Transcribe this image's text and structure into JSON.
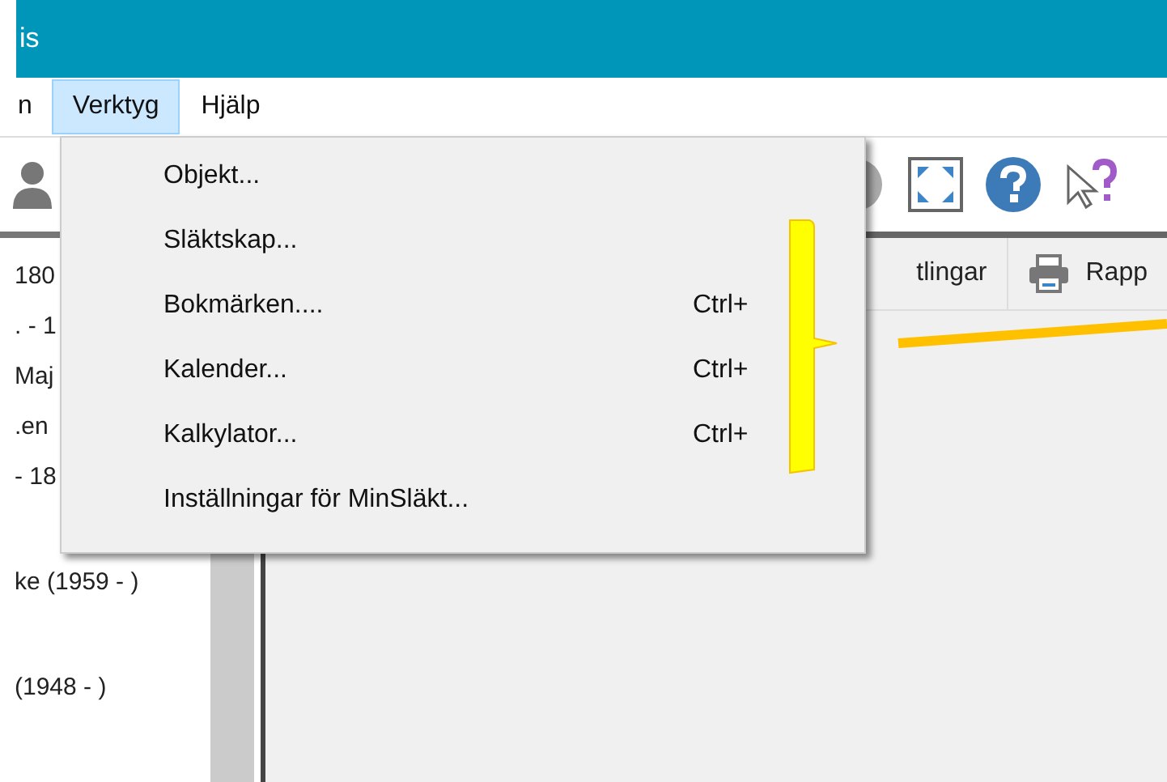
{
  "window": {
    "title": "is"
  },
  "menu_bar": [
    {
      "label": "n",
      "selected": false
    },
    {
      "label": "Verktyg",
      "selected": true
    },
    {
      "label": "Hjälp",
      "selected": false
    }
  ],
  "toolbar": {
    "items": [
      {
        "kind": "person"
      },
      {
        "kind": "disc"
      },
      {
        "kind": "fullscreen"
      },
      {
        "kind": "help"
      },
      {
        "kind": "pointer-help"
      }
    ]
  },
  "secondary_toolbar": [
    {
      "label": "tlingar",
      "kind": "text"
    },
    {
      "label": "Rapp",
      "kind": "print"
    }
  ],
  "tree": [
    "180",
    ". - 1",
    "Maj",
    ".en",
    "- 18"
  ],
  "tree_lower": [
    "ke (1959 - )",
    "(1948 - )"
  ],
  "dropdown_menu": [
    {
      "label": "Objekt..."
    },
    {
      "label": "Släktskap..."
    },
    {
      "label": "Bokmärken....",
      "shortcut": "Ctrl+"
    },
    {
      "label": "Kalender...",
      "shortcut": "Ctrl+"
    },
    {
      "label": "Kalkylator...",
      "shortcut": "Ctrl+"
    },
    {
      "label": "Inställningar för MinSläkt..."
    }
  ]
}
